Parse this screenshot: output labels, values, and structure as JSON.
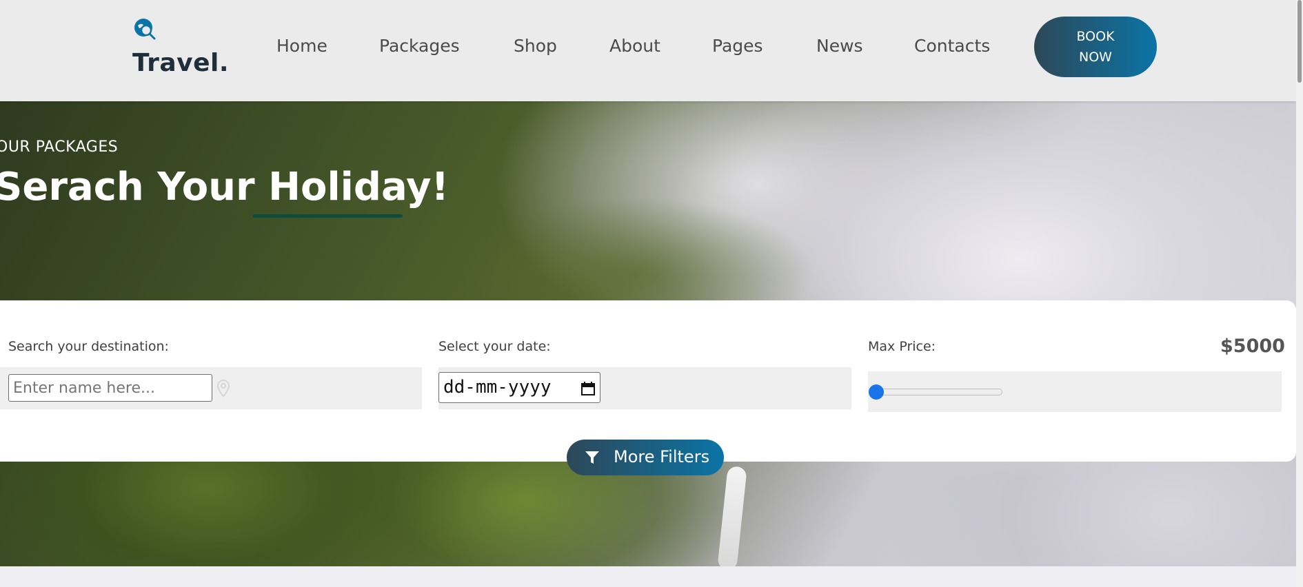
{
  "header": {
    "brand": "Travel.",
    "nav": [
      {
        "label": "Home"
      },
      {
        "label": "Packages"
      },
      {
        "label": "Shop"
      },
      {
        "label": "About"
      },
      {
        "label": "Pages"
      },
      {
        "label": "News"
      },
      {
        "label": "Contacts"
      }
    ],
    "book_line1": "BOOK",
    "book_line2": "NOW"
  },
  "hero": {
    "eyebrow": "OUR PACKAGES",
    "title": "Serach Your Holiday!"
  },
  "search": {
    "destination_label": "Search your destination:",
    "destination_placeholder": "Enter name here...",
    "date_label": "Select your date:",
    "date_value": "dd-mm-yyyy",
    "price_label": "Max Price:",
    "price_value": "$5000",
    "price_slider_fraction": 0,
    "more_filters": "More Filters"
  },
  "icons": {
    "logo": "globe-search-icon",
    "location": "map-pin-icon",
    "calendar": "calendar-icon",
    "filter": "funnel-icon"
  },
  "colors": {
    "brand_dark": "#1f2e3b",
    "button_gradient_start": "#2d4858",
    "button_gradient_end": "#0b74a6",
    "accent_underline": "#0d4d3a",
    "slider_thumb": "#1a73e8"
  }
}
